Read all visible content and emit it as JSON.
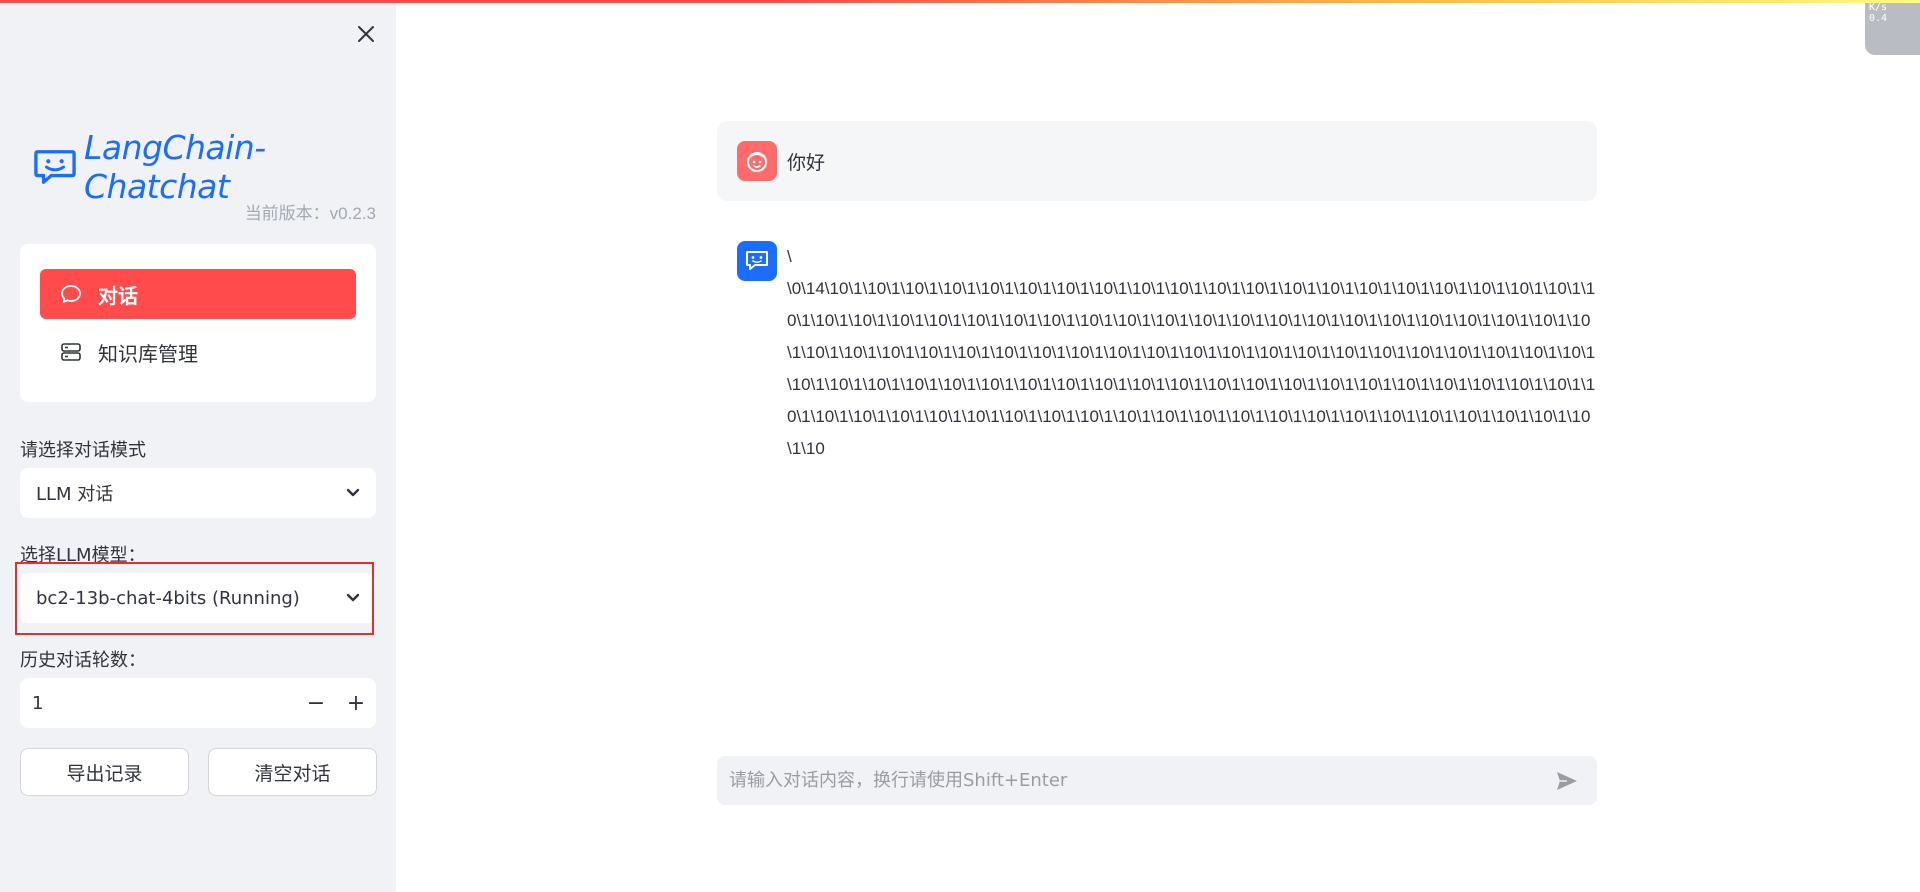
{
  "app": {
    "title": "LangChain-Chatchat",
    "version_label": "当前版本：v0.2.3"
  },
  "colors": {
    "accent": "#ff4b4b",
    "brand": "#1a6dff",
    "sidebar_bg": "#f0f2f6"
  },
  "sidebar": {
    "menu": [
      {
        "label": "对话",
        "icon": "chat-bubble-icon",
        "active": true
      },
      {
        "label": "知识库管理",
        "icon": "database-icon",
        "active": false
      }
    ],
    "mode_label": "请选择对话模式",
    "mode_value": "LLM 对话",
    "model_label": "选择LLM模型：",
    "model_value": "bc2-13b-chat-4bits (Running)",
    "history_label": "历史对话轮数：",
    "history_value": "1",
    "minus": "−",
    "plus": "+",
    "export_button": "导出记录",
    "clear_button": "清空对话"
  },
  "chat": {
    "messages": [
      {
        "role": "user",
        "avatar_icon": "user-face-icon",
        "text": "你好"
      },
      {
        "role": "assistant",
        "avatar_icon": "bot-chat-icon",
        "text": "\\\n\\0\\14\\10\\1\\10\\1\\10\\1\\10\\1\\10\\1\\10\\1\\10\\1\\10\\1\\10\\1\\10\\1\\10\\1\\10\\1\\10\\1\\10\\1\\10\\1\\10\\1\\10\\1\\10\\1\\10\\1\\10\\1\\10\\1\\10\\1\\10\\1\\10\\1\\10\\1\\10\\1\\10\\1\\10\\1\\10\\1\\10\\1\\10\\1\\10\\1\\10\\1\\10\\1\\10\\1\\10\\1\\10\\1\\10\\1\\10\\1\\10\\1\\10\\1\\10\\1\\10\\1\\10\\1\\10\\1\\10\\1\\10\\1\\10\\1\\10\\1\\10\\1\\10\\1\\10\\1\\10\\1\\10\\1\\10\\1\\10\\1\\10\\1\\10\\1\\10\\1\\10\\1\\10\\1\\10\\1\\10\\1\\10\\1\\10\\1\\10\\1\\10\\1\\10\\1\\10\\1\\10\\1\\10\\1\\10\\1\\10\\1\\10\\1\\10\\1\\10\\1\\10\\1\\10\\1\\10\\1\\10\\1\\10\\1\\10\\1\\10\\1\\10\\1\\10\\1\\10\\1\\10\\1\\10\\1\\10\\1\\10\\1\\10\\1\\10\\1\\10\\1\\10\\1\\10\\1\\10\\1\\10\\1\\10\\1\\10\\1\\10\\1\\10\\1\\10\\1\\10\\1\\10\\1\\10\\1\\10\\1\\10"
      }
    ],
    "input_placeholder": "请输入对话内容，换行请使用Shift+Enter",
    "send_icon": "send-icon"
  },
  "net_widget": {
    "unit": "K/s",
    "value": "0.4"
  }
}
